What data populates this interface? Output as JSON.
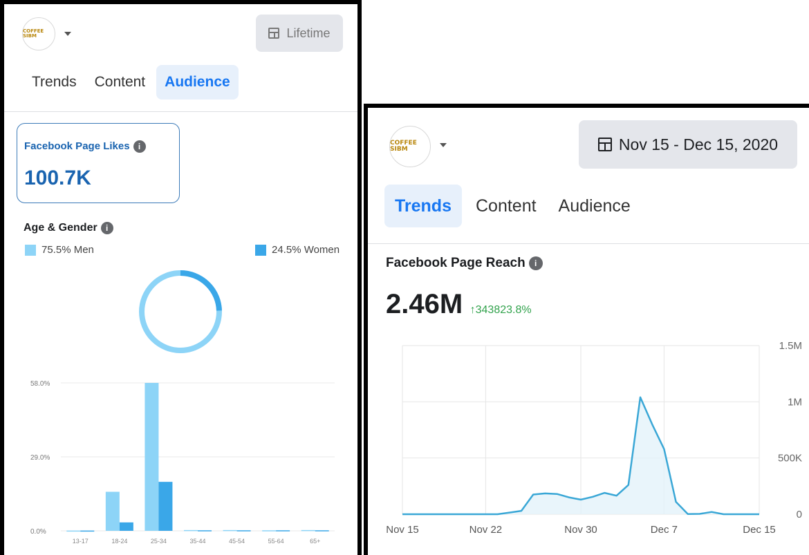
{
  "left_panel": {
    "logo_text": "COFFEE SIBM",
    "date_range": "Lifetime",
    "tabs": [
      {
        "label": "Trends",
        "active": false
      },
      {
        "label": "Content",
        "active": false
      },
      {
        "label": "Audience",
        "active": true
      }
    ],
    "likes_card": {
      "title": "Facebook Page Likes",
      "value": "100.7K"
    },
    "age_gender": {
      "title": "Age & Gender",
      "men_label": "75.5% Men",
      "women_label": "24.5% Women",
      "men_pct": 75.5,
      "women_pct": 24.5,
      "men_color": "#8dd4f7",
      "women_color": "#3aa7e8"
    }
  },
  "right_panel": {
    "logo_text": "COFFEE SIBM",
    "date_range": "Nov 15 - Dec 15, 2020",
    "tabs": [
      {
        "label": "Trends",
        "active": true
      },
      {
        "label": "Content",
        "active": false
      },
      {
        "label": "Audience",
        "active": false
      }
    ],
    "reach_title": "Facebook Page Reach",
    "reach_value": "2.46M",
    "reach_change": "↑343823.8%",
    "change_color": "#31a24c"
  },
  "chart_data": [
    {
      "type": "bar",
      "categories": [
        "13-17",
        "18-24",
        "25-34",
        "35-44",
        "45-54",
        "55-64",
        "65+"
      ],
      "series": [
        {
          "name": "Men",
          "values": [
            0.1,
            15.3,
            58.0,
            0.3,
            0.3,
            0.2,
            0.3
          ]
        },
        {
          "name": "Women",
          "values": [
            0.1,
            3.3,
            19.2,
            0.2,
            0.2,
            0.2,
            0.2
          ]
        }
      ],
      "yticks": [
        "0.0%",
        "29.0%",
        "58.0%"
      ],
      "ylim": [
        0,
        58
      ],
      "colors": [
        "#8dd4f7",
        "#3aa7e8"
      ]
    },
    {
      "type": "area",
      "x": [
        "Nov 15",
        "Nov 16",
        "Nov 17",
        "Nov 18",
        "Nov 19",
        "Nov 20",
        "Nov 21",
        "Nov 22",
        "Nov 23",
        "Nov 24",
        "Nov 25",
        "Nov 26",
        "Nov 27",
        "Nov 28",
        "Nov 29",
        "Nov 30",
        "Dec 1",
        "Dec 2",
        "Dec 3",
        "Dec 4",
        "Dec 5",
        "Dec 6",
        "Dec 7",
        "Dec 8",
        "Dec 9",
        "Dec 10",
        "Dec 11",
        "Dec 12",
        "Dec 13",
        "Dec 14",
        "Dec 15"
      ],
      "y": [
        0,
        0,
        0,
        0,
        0,
        0,
        0,
        0,
        0,
        0,
        0,
        0,
        0,
        0,
        0,
        0,
        0,
        0,
        0,
        0,
        0,
        0,
        0,
        0,
        0,
        1000,
        0,
        0,
        0,
        0,
        0
      ],
      "y_real": [
        0,
        0,
        0,
        0,
        0,
        0,
        0,
        0,
        0,
        0,
        0,
        0,
        0,
        0,
        0,
        0,
        0,
        0,
        0,
        0,
        0,
        0,
        0,
        0,
        0,
        0,
        0,
        0,
        0,
        0,
        0
      ],
      "xticks": [
        "Nov 15",
        "Nov 22",
        "Nov 30",
        "Dec 7",
        "Dec 15"
      ],
      "yticks": [
        "0",
        "500K",
        "1M",
        "1.5M"
      ],
      "ylim": [
        0,
        1500000
      ],
      "color": "#3aa7d6"
    }
  ]
}
